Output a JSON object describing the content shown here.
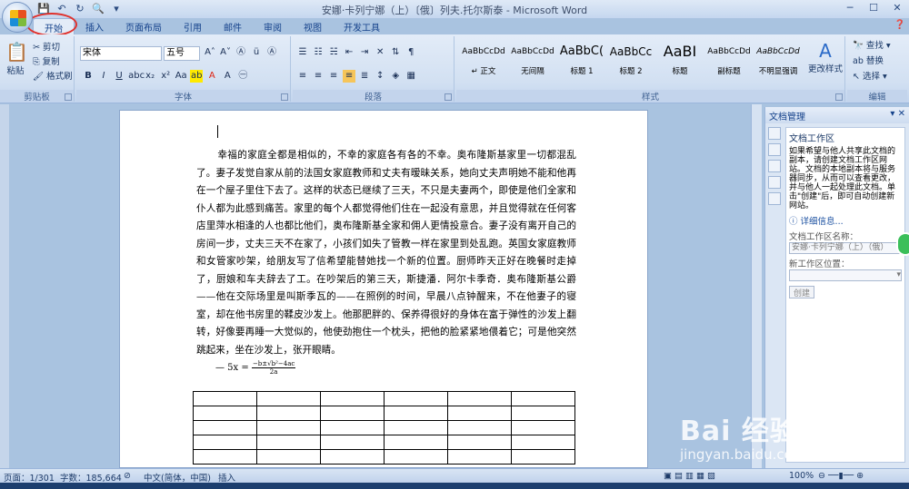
{
  "window": {
    "title": "安娜·卡列宁娜（上）〔俄〕列夫.托尔斯泰 - Microsoft Word"
  },
  "tabs": [
    "开始",
    "插入",
    "页面布局",
    "引用",
    "邮件",
    "审阅",
    "视图",
    "开发工具"
  ],
  "ribbon": {
    "clipboard": {
      "paste": "粘贴",
      "cut": "剪切",
      "copy": "复制",
      "format_painter": "格式刷",
      "label": "剪贴板"
    },
    "font": {
      "name": "宋体",
      "size": "五号",
      "label": "字体"
    },
    "paragraph": {
      "label": "段落"
    },
    "styles": {
      "label": "样式",
      "items": [
        {
          "sample": "AaBbCcDd",
          "name": "↵ 正文"
        },
        {
          "sample": "AaBbCcDd",
          "name": "无间隔"
        },
        {
          "sample": "AaBbC(",
          "name": "标题 1"
        },
        {
          "sample": "AaBbCc",
          "name": "标题 2"
        },
        {
          "sample": "AaBI",
          "name": "标题"
        },
        {
          "sample": "AaBbCcDd",
          "name": "副标题"
        },
        {
          "sample": "AaBbCcDd",
          "name": "不明显强调"
        }
      ],
      "change": "更改样式"
    },
    "editing": {
      "find": "查找",
      "replace": "替换",
      "select": "选择",
      "label": "编辑"
    }
  },
  "document": {
    "paragraph": "幸福的家庭全都是相似的，不幸的家庭各有各的不幸。奥布隆斯基家里一切都混乱了。妻子发觉自家从前的法国女家庭教师和丈夫有暧昧关系，她向丈夫声明她不能和他再在一个屋子里住下去了。这样的状态已继续了三天，不只是夫妻两个，即使是他们全家和仆人都为此感到痛苦。家里的每个人都觉得他们住在一起没有意思，并且觉得就在任何客店里萍水相逢的人也都比他们，奥布隆斯基全家和佣人更情投意合。妻子没有离开自己的房间一步，丈夫三天不在家了，小孩们如失了管教一样在家里到处乱跑。英国女家庭教师和女管家吵架，给朋友写了信希望能替她找一个新的位置。厨师昨天正好在晚餐时走掉了，厨娘和车夫辞去了工。在吵架后的第三天，斯捷潘．阿尔卡季奇．奥布隆斯基公爵——他在交际场里是叫斯季瓦的——在照例的时间，早晨八点钟醒来，不在他妻子的寝室，却在他书房里的鞣皮沙发上。他那肥胖的、保养得很好的身体在富于弹性的沙发上翻转，好像要再睡一大觉似的，他使劲抱住一个枕头，把他的脸紧紧地偎着它；可是他突然跳起来，坐在沙发上，张开眼睛。",
    "formula_prefix": "— 5x =",
    "formula_num": "−b±√b²−4ac",
    "formula_den": "2a"
  },
  "pane": {
    "title": "文档管理",
    "section": "文档工作区",
    "description": "如果希望与他人共享此文档的副本，请创建文档工作区网站。文档的本地副本将与服务器同步，从而可以查看更改，并与他人一起处理此文档。单击\"创建\"后，即可自动创建新网站。",
    "more_info": "详细信息...",
    "name_label": "文档工作区名称：",
    "name_value": "安娜·卡列宁娜（上）（俄）",
    "location_label": "新工作区位置：",
    "create_button": "创建"
  },
  "status": {
    "page": "页面：1/301",
    "words": "字数：185,664",
    "language": "中文(简体，中国)",
    "mode": "插入",
    "zoom": "100%"
  },
  "watermark": {
    "main": "Bai 经验",
    "sub": "jingyan.baidu.com"
  }
}
